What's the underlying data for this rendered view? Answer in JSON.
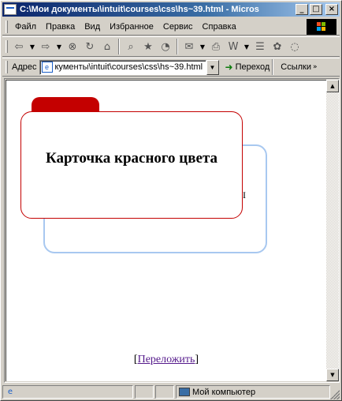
{
  "window": {
    "title": "C:\\Мои документы\\intuit\\courses\\css\\hs~39.html - Micros",
    "controls": {
      "minimize": "_",
      "maximize": "□",
      "close": "×"
    }
  },
  "menu": {
    "items": [
      {
        "label": "Файл"
      },
      {
        "label": "Правка"
      },
      {
        "label": "Вид"
      },
      {
        "label": "Избранное"
      },
      {
        "label": "Сервис"
      },
      {
        "label": "Справка"
      }
    ]
  },
  "toolbar": {
    "icons": [
      "back-icon",
      "forward-icon",
      "stop-icon",
      "refresh-icon",
      "home-icon",
      "search-icon",
      "favorites-icon",
      "history-icon",
      "mail-icon",
      "print-icon",
      "edit-icon",
      "discuss-icon",
      "messenger-icon"
    ]
  },
  "address": {
    "label": "Адрес",
    "value": "кументы\\intuit\\courses\\css\\hs~39.html",
    "go_label": "Переход",
    "links_label": "Ссылки"
  },
  "page": {
    "red_card_title": "Карточка красного цвета",
    "blue_card_text": "I",
    "rearrange": {
      "open_bracket": "[",
      "link_label": "Переложить",
      "close_bracket": "]"
    }
  },
  "status": {
    "zone_label": "Мой компьютер"
  },
  "colors": {
    "red_card": "#c40000",
    "blue_card_border": "#a8c8f0",
    "title_bar": "#0a246a",
    "visited_link": "#551a8b"
  }
}
